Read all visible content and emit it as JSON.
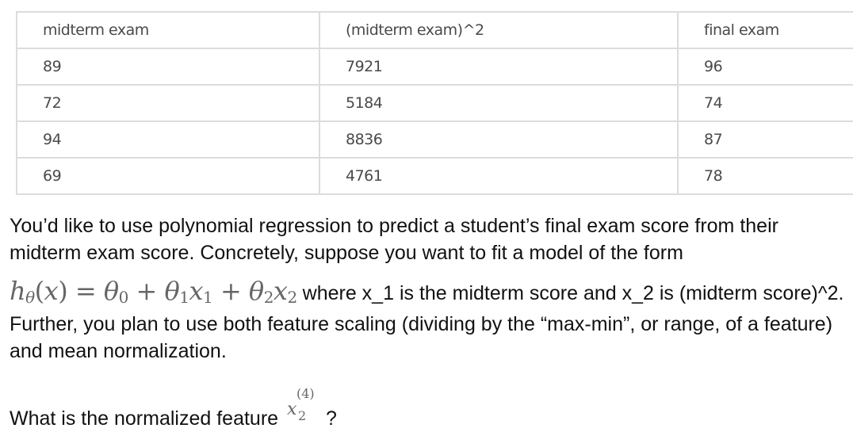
{
  "table": {
    "headers": [
      "midterm exam",
      "(midterm exam)^2",
      "final exam"
    ],
    "rows": [
      [
        "89",
        "7921",
        "96"
      ],
      [
        "72",
        "5184",
        "74"
      ],
      [
        "94",
        "8836",
        "87"
      ],
      [
        "69",
        "4761",
        "78"
      ]
    ]
  },
  "paragraph1": "You’d like to use polynomial regression to predict a student’s final exam score from their midterm exam score. Concretely, suppose you want to fit a model of the form",
  "formula": {
    "h": "h",
    "theta": "θ",
    "x": "x",
    "eq": " = ",
    "plus": " + ",
    "sub0": "0",
    "sub1": "1",
    "sub2": "2",
    "open": "(",
    "close": ")"
  },
  "paragraph2_rest": " where x_1 is the midterm score and x_2 is (midterm score)^2. Further, you plan to use both feature scaling (dividing by the “max-min”, or range, of a feature) and mean normalization.",
  "question_prefix": "What is the normalized feature ",
  "feature": {
    "base": "x",
    "superscript": "(4)",
    "subscript": "2"
  },
  "question_suffix": "?"
}
